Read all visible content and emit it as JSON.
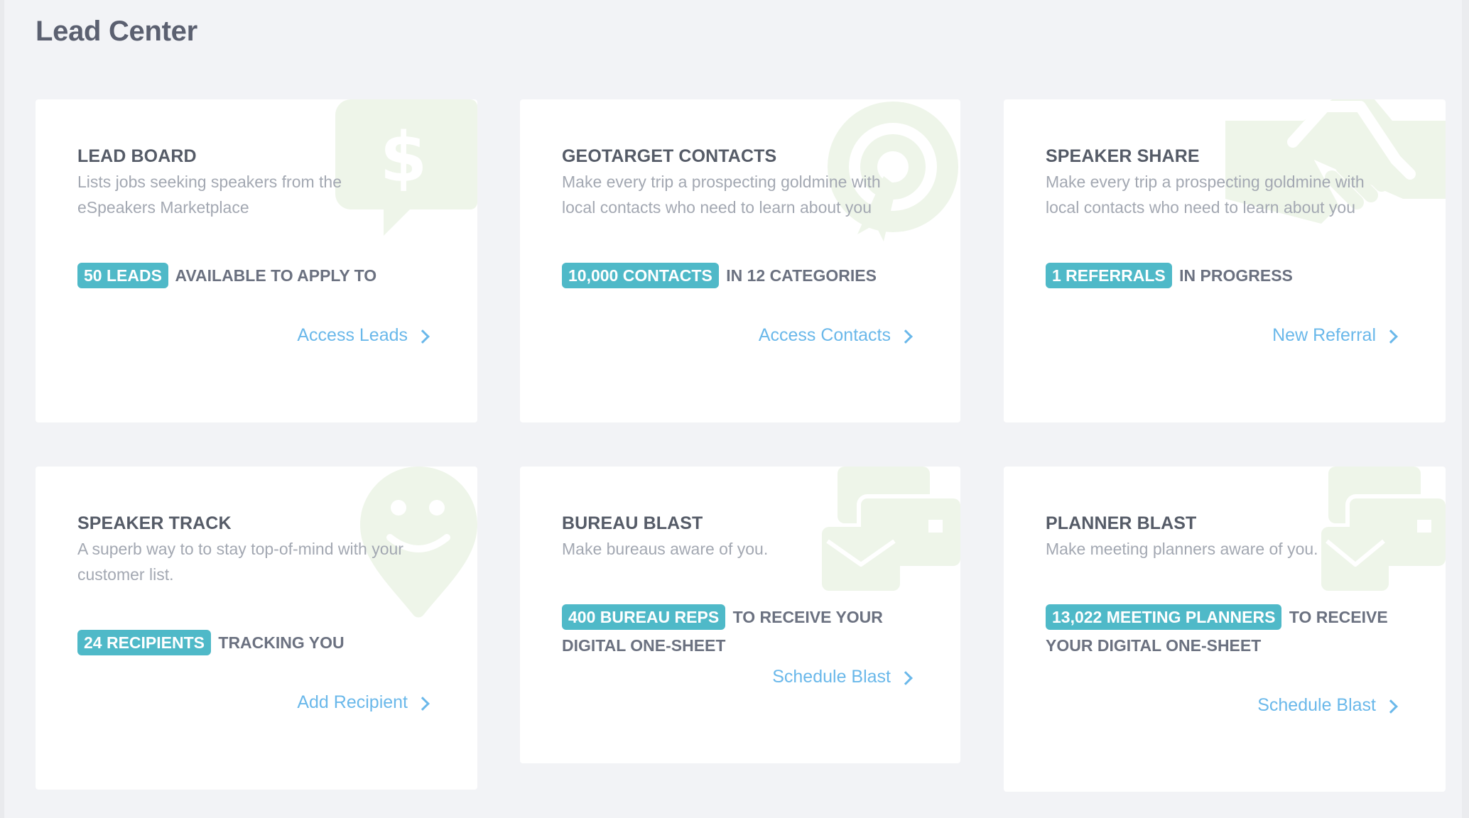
{
  "page": {
    "title": "Lead Center"
  },
  "colors": {
    "badge": "#4fb9c8",
    "link": "#6ab8ea",
    "watermark": "#eef5e9"
  },
  "cards": [
    {
      "title": "LEAD BOARD",
      "description": "Lists jobs seeking speakers from the eSpeakers Marketplace",
      "badge": "50 LEADS",
      "stat_text": "AVAILABLE TO APPLY TO",
      "link": "Access Leads",
      "icon": "dollar-speech-bubble-icon"
    },
    {
      "title": "GEOTARGET CONTACTS",
      "description": "Make every trip a prospecting goldmine with local contacts who need to learn about you",
      "badge": "10,000 CONTACTS",
      "stat_text": "IN 12 CATEGORIES",
      "link": "Access Contacts",
      "icon": "target-icon"
    },
    {
      "title": "SPEAKER SHARE",
      "description": "Make every trip a prospecting goldmine with local contacts who need to learn about you",
      "badge": "1 REFERRALS",
      "stat_text": "IN PROGRESS",
      "link": "New Referral",
      "icon": "handshake-icon"
    },
    {
      "title": "SPEAKER TRACK",
      "description": "A superb way to to stay top-of-mind with your customer list.",
      "badge": "24 RECIPIENTS",
      "stat_text": "TRACKING YOU",
      "link": "Add Recipient",
      "icon": "smiley-pin-icon"
    },
    {
      "title": "BUREAU BLAST",
      "description": "Make bureaus aware of you.",
      "badge": "400 BUREAU REPS",
      "stat_text": "TO RECEIVE YOUR DIGITAL ONE-SHEET",
      "link": "Schedule Blast",
      "icon": "envelopes-icon"
    },
    {
      "title": "PLANNER BLAST",
      "description": "Make meeting planners aware of you.",
      "badge": "13,022 MEETING PLANNERS",
      "stat_text": "TO RECEIVE YOUR DIGITAL ONE-SHEET",
      "link": "Schedule Blast",
      "icon": "envelopes-icon"
    }
  ]
}
